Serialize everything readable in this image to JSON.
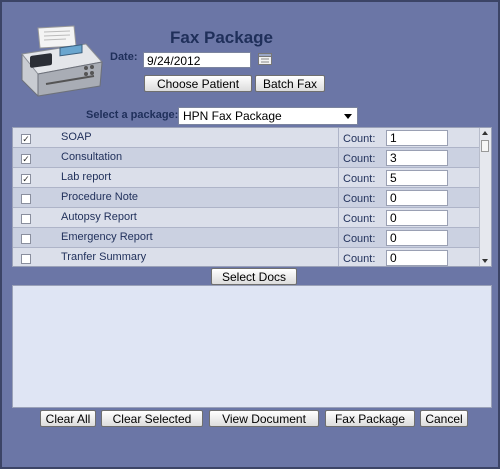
{
  "header": {
    "title": "Fax Package"
  },
  "date": {
    "label": "Date:",
    "value": "9/24/2012"
  },
  "top_buttons": {
    "choose_patient": "Choose Patient",
    "batch_fax": "Batch Fax"
  },
  "package": {
    "label": "Select a package:",
    "selected": "HPN Fax Package"
  },
  "documents": [
    {
      "label": "SOAP",
      "checked": true,
      "count_label": "Count:",
      "count": "1"
    },
    {
      "label": "Consultation",
      "checked": true,
      "count_label": "Count:",
      "count": "3"
    },
    {
      "label": "Lab report",
      "checked": true,
      "count_label": "Count:",
      "count": "5"
    },
    {
      "label": "Procedure Note",
      "checked": false,
      "count_label": "Count:",
      "count": "0"
    },
    {
      "label": "Autopsy Report",
      "checked": false,
      "count_label": "Count:",
      "count": "0"
    },
    {
      "label": "Emergency Report",
      "checked": false,
      "count_label": "Count:",
      "count": "0"
    },
    {
      "label": "Tranfer Summary",
      "checked": false,
      "count_label": "Count:",
      "count": "0"
    }
  ],
  "select_docs_label": "Select Docs",
  "bottom_buttons": {
    "clear_all": "Clear All",
    "clear_selected": "Clear Selected",
    "view_document": "View Document",
    "fax_package": "Fax Package",
    "cancel": "Cancel"
  },
  "colors": {
    "background": "#6b76a6",
    "title": "#1f2f5a",
    "list_bg": "#cfd4e4",
    "docs_bg": "#dfe5f4"
  },
  "icons": {
    "fax_machine": "fax-machine-icon",
    "calendar": "calendar-icon"
  }
}
